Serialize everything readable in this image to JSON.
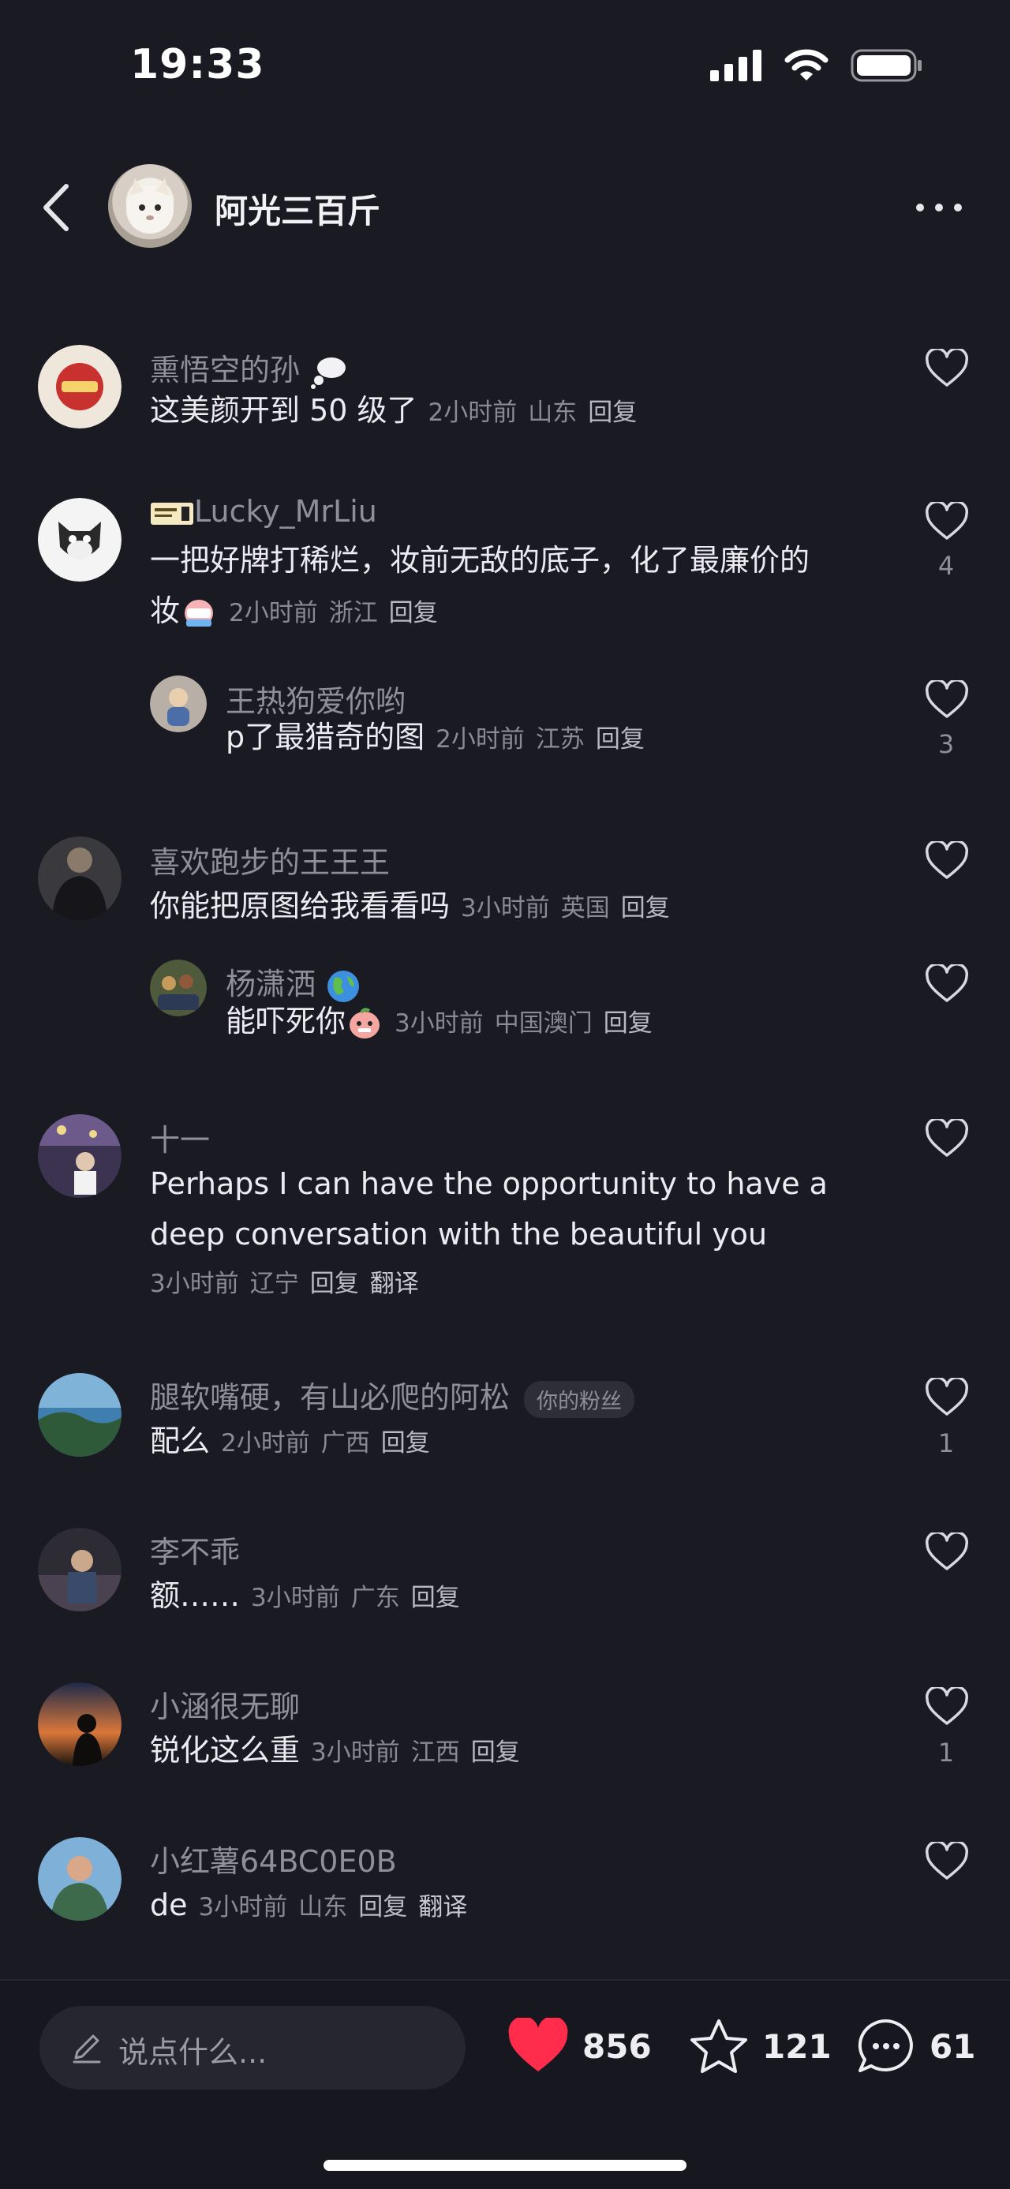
{
  "status": {
    "time": "19:33"
  },
  "header": {
    "username": "阿光三百斤"
  },
  "comments": [
    {
      "name": "熏悟空的孙",
      "text": "这美颜开到 50 级了",
      "time": "2小时前",
      "location": "山东",
      "reply": "回复",
      "likes": ""
    },
    {
      "name": "Lucky_MrLiu",
      "text_line1": "一把好牌打稀烂，妆前无敌的底子，化了最廉价的",
      "text_line2": "妆",
      "time": "2小时前",
      "location": "浙江",
      "reply": "回复",
      "likes": "4"
    },
    {
      "name": "王热狗爱你哟",
      "text": "p了最猎奇的图",
      "time": "2小时前",
      "location": "江苏",
      "reply": "回复",
      "likes": "3"
    },
    {
      "name": "喜欢跑步的王王王",
      "text": "你能把原图给我看看吗",
      "time": "3小时前",
      "location": "英国",
      "reply": "回复",
      "likes": ""
    },
    {
      "name": "杨潇洒",
      "text": "能吓死你",
      "time": "3小时前",
      "location": "中国澳门",
      "reply": "回复",
      "likes": ""
    },
    {
      "name": "十一",
      "text_line1": "Perhaps I can have the opportunity to have a",
      "text_line2": "deep conversation with the beautiful you",
      "time": "3小时前",
      "location": "辽宁",
      "reply": "回复",
      "translate": "翻译",
      "likes": ""
    },
    {
      "name": "腿软嘴硬，有山必爬的阿松",
      "badge": "你的粉丝",
      "text": "配么",
      "time": "2小时前",
      "location": "广西",
      "reply": "回复",
      "likes": "1"
    },
    {
      "name": "李不乖",
      "text": "额……",
      "time": "3小时前",
      "location": "广东",
      "reply": "回复",
      "likes": ""
    },
    {
      "name": "小涵很无聊",
      "text": "锐化这么重",
      "time": "3小时前",
      "location": "江西",
      "reply": "回复",
      "likes": "1"
    },
    {
      "name": "小红薯64BC0E0B",
      "text": "de",
      "time": "3小时前",
      "location": "山东",
      "reply": "回复",
      "translate": "翻译",
      "likes": ""
    }
  ],
  "bottom": {
    "placeholder": "说点什么...",
    "likes": "856",
    "favorites": "121",
    "comments": "61"
  },
  "colors": {
    "background": "#1a1a23",
    "heart": "#ff2c4b"
  }
}
